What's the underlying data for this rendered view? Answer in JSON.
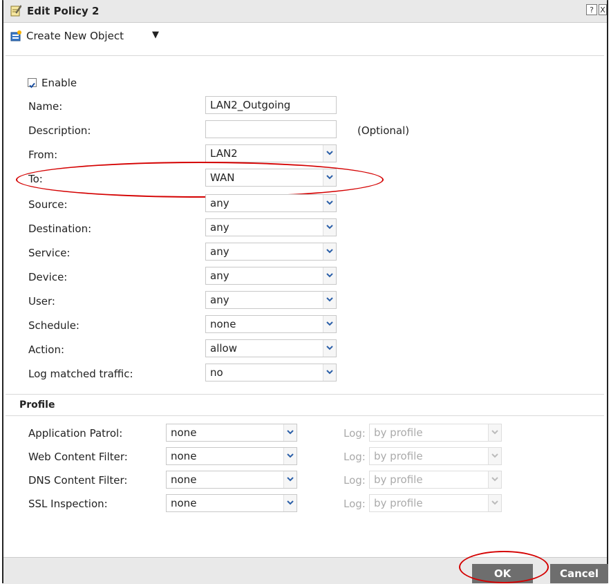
{
  "window": {
    "title": "Edit Policy 2",
    "help_glyph": "?",
    "close_glyph": "X"
  },
  "toolbar": {
    "create_label": "Create New Object",
    "create_arrow": "▼"
  },
  "form": {
    "enable_label": "Enable",
    "enable_checked": true,
    "name_label": "Name:",
    "name_value": "LAN2_Outgoing",
    "description_label": "Description:",
    "description_value": "",
    "optional_label": "(Optional)",
    "from_label": "From:",
    "from_value": "LAN2",
    "to_label": "To:",
    "to_value": "WAN",
    "source_label": "Source:",
    "source_value": "any",
    "destination_label": "Destination:",
    "destination_value": "any",
    "service_label": "Service:",
    "service_value": "any",
    "device_label": "Device:",
    "device_value": "any",
    "user_label": "User:",
    "user_value": "any",
    "schedule_label": "Schedule:",
    "schedule_value": "none",
    "action_label": "Action:",
    "action_value": "allow",
    "log_label": "Log matched traffic:",
    "log_value": "no"
  },
  "profile": {
    "title": "Profile",
    "log_label": "Log:",
    "rows": [
      {
        "label": "Application Patrol:",
        "value": "none",
        "log_value": "by profile"
      },
      {
        "label": "Web Content Filter:",
        "value": "none",
        "log_value": "by profile"
      },
      {
        "label": "DNS Content Filter:",
        "value": "none",
        "log_value": "by profile"
      },
      {
        "label": "SSL Inspection:",
        "value": "none",
        "log_value": "by profile"
      }
    ]
  },
  "buttons": {
    "ok": "OK",
    "cancel": "Cancel"
  },
  "colors": {
    "highlight": "#d40000",
    "button": "#6e6e6e"
  }
}
